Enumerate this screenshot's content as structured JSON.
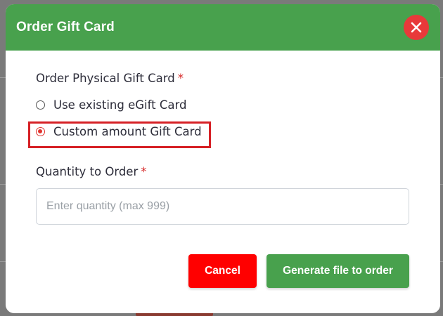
{
  "dialog": {
    "title": "Order Gift Card",
    "close_icon": "close-icon",
    "colors": {
      "header": "#48a14d",
      "close": "#e8393a",
      "cancel": "#ff0000",
      "primary": "#48a14d",
      "required": "#d62828"
    }
  },
  "physical_card": {
    "label": "Order Physical Gift Card",
    "required_mark": "*",
    "options": [
      {
        "label": "Use existing eGift Card",
        "selected": false
      },
      {
        "label": "Custom amount Gift Card",
        "selected": true
      }
    ]
  },
  "quantity": {
    "label": "Quantity to Order",
    "required_mark": "*",
    "value": "",
    "placeholder": "Enter quantity (max 999)"
  },
  "actions": {
    "cancel_label": "Cancel",
    "generate_label": "Generate file to order"
  }
}
